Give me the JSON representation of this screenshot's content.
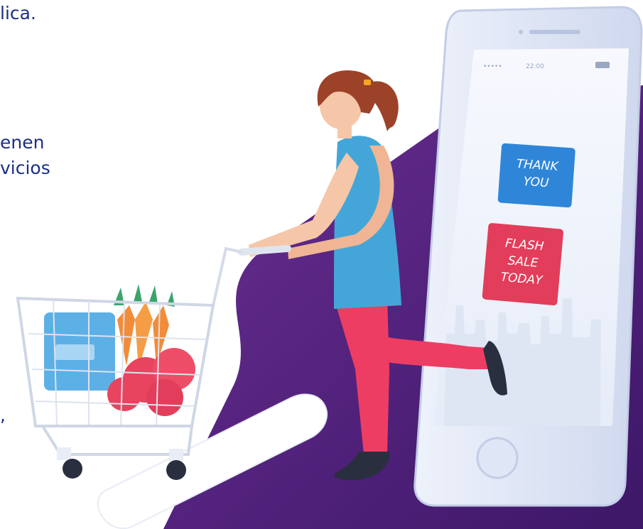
{
  "paragraph": {
    "fragments": [
      "lica.",
      "enen",
      "vicios",
      ","
    ]
  },
  "phone": {
    "status_time": "22:00",
    "status_signal": "•••••",
    "thank_you_lines": [
      "THANK",
      "YOU"
    ],
    "flash_sale_lines": [
      "FLASH",
      "SALE",
      "TODAY"
    ]
  },
  "colors": {
    "text": "#1a2f82",
    "purple": "#5e2a86",
    "purple_dark": "#3f1a6c",
    "phone_body": "#dde4f4",
    "thank_you_bg": "#2f86d8",
    "flash_sale_bg": "#e23d5a",
    "shirt": "#44a6d8",
    "pants": "#ee3d63",
    "hair": "#9c4228"
  }
}
